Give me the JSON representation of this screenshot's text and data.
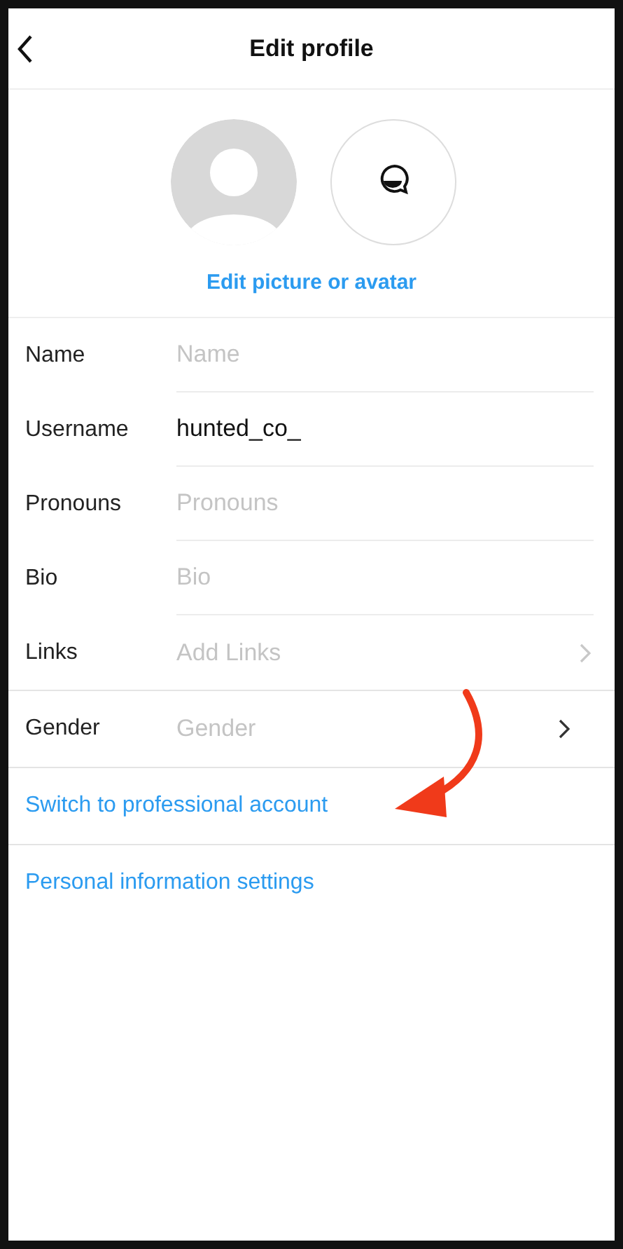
{
  "header": {
    "title": "Edit profile"
  },
  "avatar": {
    "link": "Edit picture or avatar"
  },
  "fields": [
    {
      "label": "Name",
      "kind": "text",
      "placeholder": "Name"
    },
    {
      "label": "Username",
      "kind": "text",
      "value": "hunted_co_"
    },
    {
      "label": "Pronouns",
      "kind": "text",
      "placeholder": "Pronouns"
    },
    {
      "label": "Bio",
      "kind": "text",
      "placeholder": "Bio"
    },
    {
      "label": "Links",
      "kind": "link",
      "placeholder": "Add Links"
    }
  ],
  "gender": {
    "label": "Gender",
    "placeholder": "Gender"
  },
  "links": [
    "Switch to professional account",
    "Personal information settings"
  ]
}
